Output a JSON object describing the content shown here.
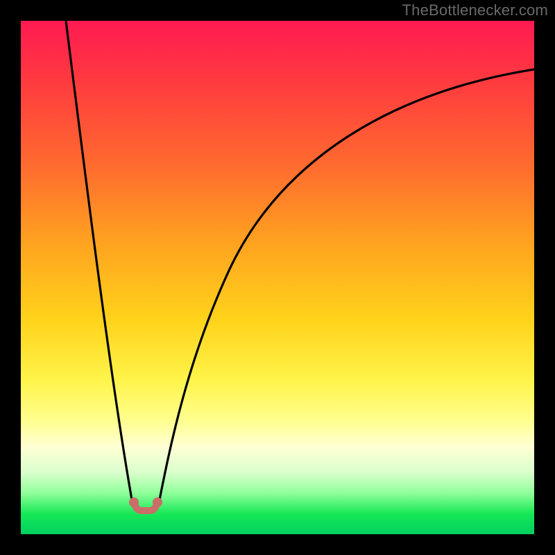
{
  "watermark": "TheBottlenecker.com",
  "colors": {
    "frame": "#000000",
    "curve": "#000000",
    "trough_marker": "#c96f67",
    "gradient_top": "#ff1a52",
    "gradient_bottom": "#00d060"
  },
  "chart_data": {
    "type": "line",
    "title": "",
    "xlabel": "",
    "ylabel": "",
    "xlim": [
      0,
      100
    ],
    "ylim": [
      0,
      100
    ],
    "background": "vertical gradient red→orange→yellow→green representing bottleneck severity (top=high, bottom=low)",
    "series": [
      {
        "name": "bottleneck-curve",
        "x": [
          8,
          10,
          12,
          14,
          16,
          18,
          20,
          22,
          24,
          25,
          26,
          28,
          30,
          34,
          40,
          50,
          60,
          75,
          90,
          100
        ],
        "values": [
          100,
          83,
          67,
          52,
          38,
          25,
          13,
          5,
          1,
          0,
          1,
          6,
          15,
          30,
          48,
          66,
          77,
          85,
          89,
          91
        ],
        "note": "V-shaped curve; sharp minimum near x≈25; steep left branch, shallower right branch that asymptotes near y≈90."
      }
    ],
    "markers": [
      {
        "name": "optimal-range",
        "x_start": 22,
        "x_end": 27,
        "y": 5,
        "shape": "U",
        "color": "#c96f67"
      }
    ],
    "annotations": [
      {
        "text": "TheBottlenecker.com",
        "position": "top-right",
        "role": "watermark"
      }
    ]
  }
}
